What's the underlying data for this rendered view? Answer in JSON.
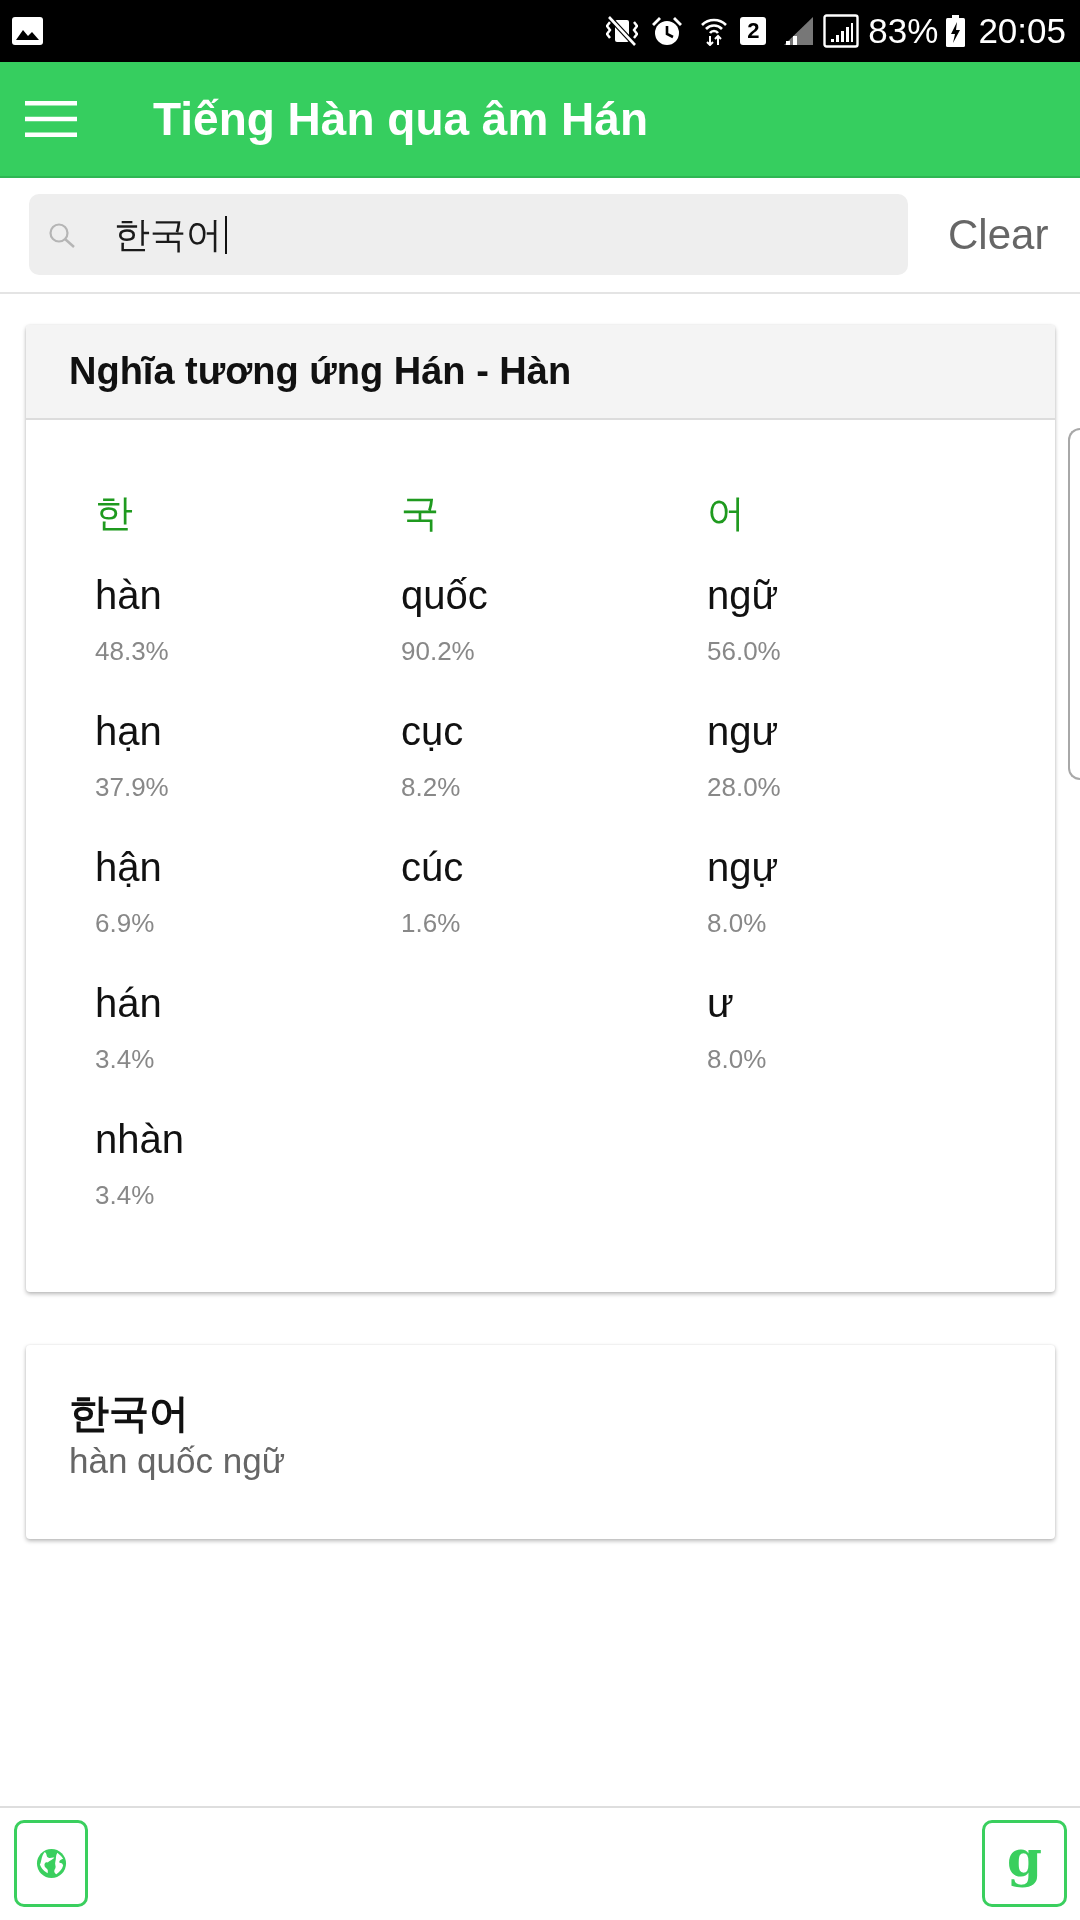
{
  "status_bar": {
    "sim_slot": "2",
    "battery": "83%",
    "time": "20:05"
  },
  "app_bar": {
    "title": "Tiếng Hàn qua âm Hán"
  },
  "search": {
    "value": "한국어",
    "clear_label": "Clear"
  },
  "mapping_card": {
    "title": "Nghĩa tương ứng Hán - Hàn",
    "columns": [
      {
        "syllable": "한",
        "readings": [
          {
            "reading": "hàn",
            "share": "48.3%"
          },
          {
            "reading": "hạn",
            "share": "37.9%"
          },
          {
            "reading": "hận",
            "share": "6.9%"
          },
          {
            "reading": "hán",
            "share": "3.4%"
          },
          {
            "reading": "nhàn",
            "share": "3.4%"
          }
        ]
      },
      {
        "syllable": "국",
        "readings": [
          {
            "reading": "quốc",
            "share": "90.2%"
          },
          {
            "reading": "cục",
            "share": "8.2%"
          },
          {
            "reading": "cúc",
            "share": "1.6%"
          }
        ]
      },
      {
        "syllable": "어",
        "readings": [
          {
            "reading": "ngữ",
            "share": "56.0%"
          },
          {
            "reading": "ngư",
            "share": "28.0%"
          },
          {
            "reading": "ngự",
            "share": "8.0%"
          },
          {
            "reading": "ư",
            "share": "8.0%"
          }
        ]
      }
    ]
  },
  "word_card": {
    "word": "한국어",
    "reading": "hàn quốc ngữ"
  },
  "bottom_bar": {
    "right_button": "g"
  }
}
